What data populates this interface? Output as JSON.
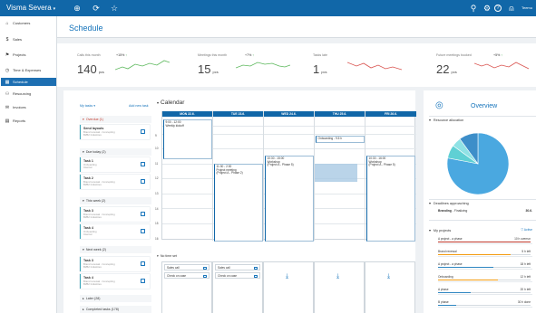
{
  "topbar": {
    "brand": "Visma Severa",
    "brand_caret": "▾",
    "user_name": "Teemu",
    "add_glyph": "⊕",
    "refresh_glyph": "⟳",
    "star_glyph": "☆",
    "search_glyph": "⚲",
    "settings_glyph": "⚙",
    "help_glyph": "?",
    "user_glyph": "⍝"
  },
  "sidebar": {
    "items": [
      {
        "label": "Customers",
        "icon": "⌂"
      },
      {
        "label": "Sales",
        "icon": "$"
      },
      {
        "label": "Projects",
        "icon": "⚑"
      },
      {
        "label": "Time & Expenses",
        "icon": "◷"
      },
      {
        "label": "Schedule",
        "icon": "▦"
      },
      {
        "label": "Resourcing",
        "icon": "⚇"
      },
      {
        "label": "Invoices",
        "icon": "✉"
      },
      {
        "label": "Reports",
        "icon": "▤"
      }
    ],
    "active_index": 4
  },
  "page": {
    "title": "Schedule"
  },
  "kpis": [
    {
      "label": "Calls this month",
      "trend": "+15%",
      "trend_arrow": "↑",
      "value": "140",
      "unit": "pcs"
    },
    {
      "label": "Meetings this month",
      "trend": "+7%",
      "trend_arrow": "↑",
      "value": "15",
      "unit": "pcs"
    },
    {
      "label": "Tasks late",
      "trend": "",
      "trend_arrow": "",
      "value": "1",
      "unit": "pcs"
    },
    {
      "label": "Future meetings booked",
      "trend": "+5%",
      "trend_arrow": "↑",
      "value": "22",
      "unit": "pcs"
    }
  ],
  "tasks": {
    "header": "My tasks",
    "header_caret": "▾",
    "add_label": "Add new task",
    "groups": [
      {
        "label": "Overdue (1)",
        "caret": "▾"
      },
      {
        "label": "Due today (2)",
        "caret": "▾"
      },
      {
        "label": "This week (2)",
        "caret": "▾"
      },
      {
        "label": "Next week (2)",
        "caret": "▾"
      },
      {
        "label": "Later (28)",
        "caret": "▸"
      },
      {
        "label": "Completed tasks (178)",
        "caret": "▸"
      }
    ],
    "items": [
      {
        "title": "Send layouts",
        "sub1": "Brand renewal - Concepting",
        "sub2": "BI/B2 Industries"
      },
      {
        "title": "Task 1",
        "sub1": "Onboarding",
        "sub2": "Internal"
      },
      {
        "title": "Task 2",
        "sub1": "Brand renewal - Concepting",
        "sub2": "BI/B2 Industries"
      },
      {
        "title": "Task 3",
        "sub1": "Brand renewal - Concepting",
        "sub2": "BI/B2 Industries"
      },
      {
        "title": "Task 4",
        "sub1": "Onboarding",
        "sub2": "Internal"
      },
      {
        "title": "Task 3",
        "sub1": "Brand renewal - Concepting",
        "sub2": "BI/B2 Industries"
      },
      {
        "title": "Task 4",
        "sub1": "Brand renewal - Concepting",
        "sub2": "BI/B2 Industries"
      }
    ]
  },
  "calendar": {
    "title": "Calendar",
    "title_caret": "▾",
    "days": [
      "MON 22.6.",
      "TUE 23.6.",
      "WED 24.6.",
      "THU 25.6.",
      "FRI 26.6."
    ],
    "hours": [
      "9",
      "10",
      "11",
      "12",
      "13",
      "14",
      "15",
      "16"
    ],
    "events": [
      {
        "title": "9:00 - 12:00",
        "sub": "Weekly kickoff",
        "sub2": ""
      },
      {
        "title": "Onboarding - 9.5 h",
        "sub": "",
        "sub2": ""
      },
      {
        "title": "11:30 - 2:30",
        "sub": "Project meeting",
        "sub2": "(Project A - Phase 2)"
      },
      {
        "title": "10:30 - 15:00",
        "sub": "Workshop",
        "sub2": "(Project A - Phase 5)"
      },
      {
        "title": "10:30 - 16:00",
        "sub": "Workshop",
        "sub2": "(Project A - Phase 5)"
      }
    ],
    "no_time_label": "No time set",
    "no_time_caret": "▾",
    "no_time_items": [
      {
        "label": "Sales call"
      },
      {
        "label": "Sales call"
      },
      {
        "label": "Check on case"
      },
      {
        "label": "Check on case"
      }
    ],
    "download_glyph": "⤓"
  },
  "overview": {
    "title": "Overview",
    "icon": "◎",
    "resource_label": "Resource allocation",
    "deadlines_label": "Deadlines approaching",
    "deadline": {
      "name": "Branding",
      "phase": "- Finalizing",
      "date": "30.6."
    },
    "myprojects_label": "My projects",
    "filter_label": "Active",
    "projects": [
      {
        "name": "A project - a phase",
        "value": "10 h overrun",
        "fill": 1.0,
        "color": "#c0392b"
      },
      {
        "name": "Brand renewal",
        "value": "5 h left",
        "fill": 0.78,
        "color": "#f39c12"
      },
      {
        "name": "A project - a phase",
        "value": "18 h left",
        "fill": 0.6,
        "color": "#2e86c1"
      },
      {
        "name": "Onboarding",
        "value": "12 h left",
        "fill": 0.65,
        "color": "#f39c12"
      },
      {
        "name": "A phase",
        "value": "20 h left",
        "fill": 0.35,
        "color": "#2e86c1"
      },
      {
        "name": "B phase",
        "value": "30 h done",
        "fill": 0.2,
        "color": "#2e86c1"
      }
    ],
    "pie": [
      {
        "value": 78,
        "color": "#4aa8e0"
      },
      {
        "value": 7,
        "color": "#5fd0d4"
      },
      {
        "value": 5,
        "color": "#8fe2e5"
      },
      {
        "value": 10,
        "color": "#3d8ec9"
      }
    ]
  }
}
